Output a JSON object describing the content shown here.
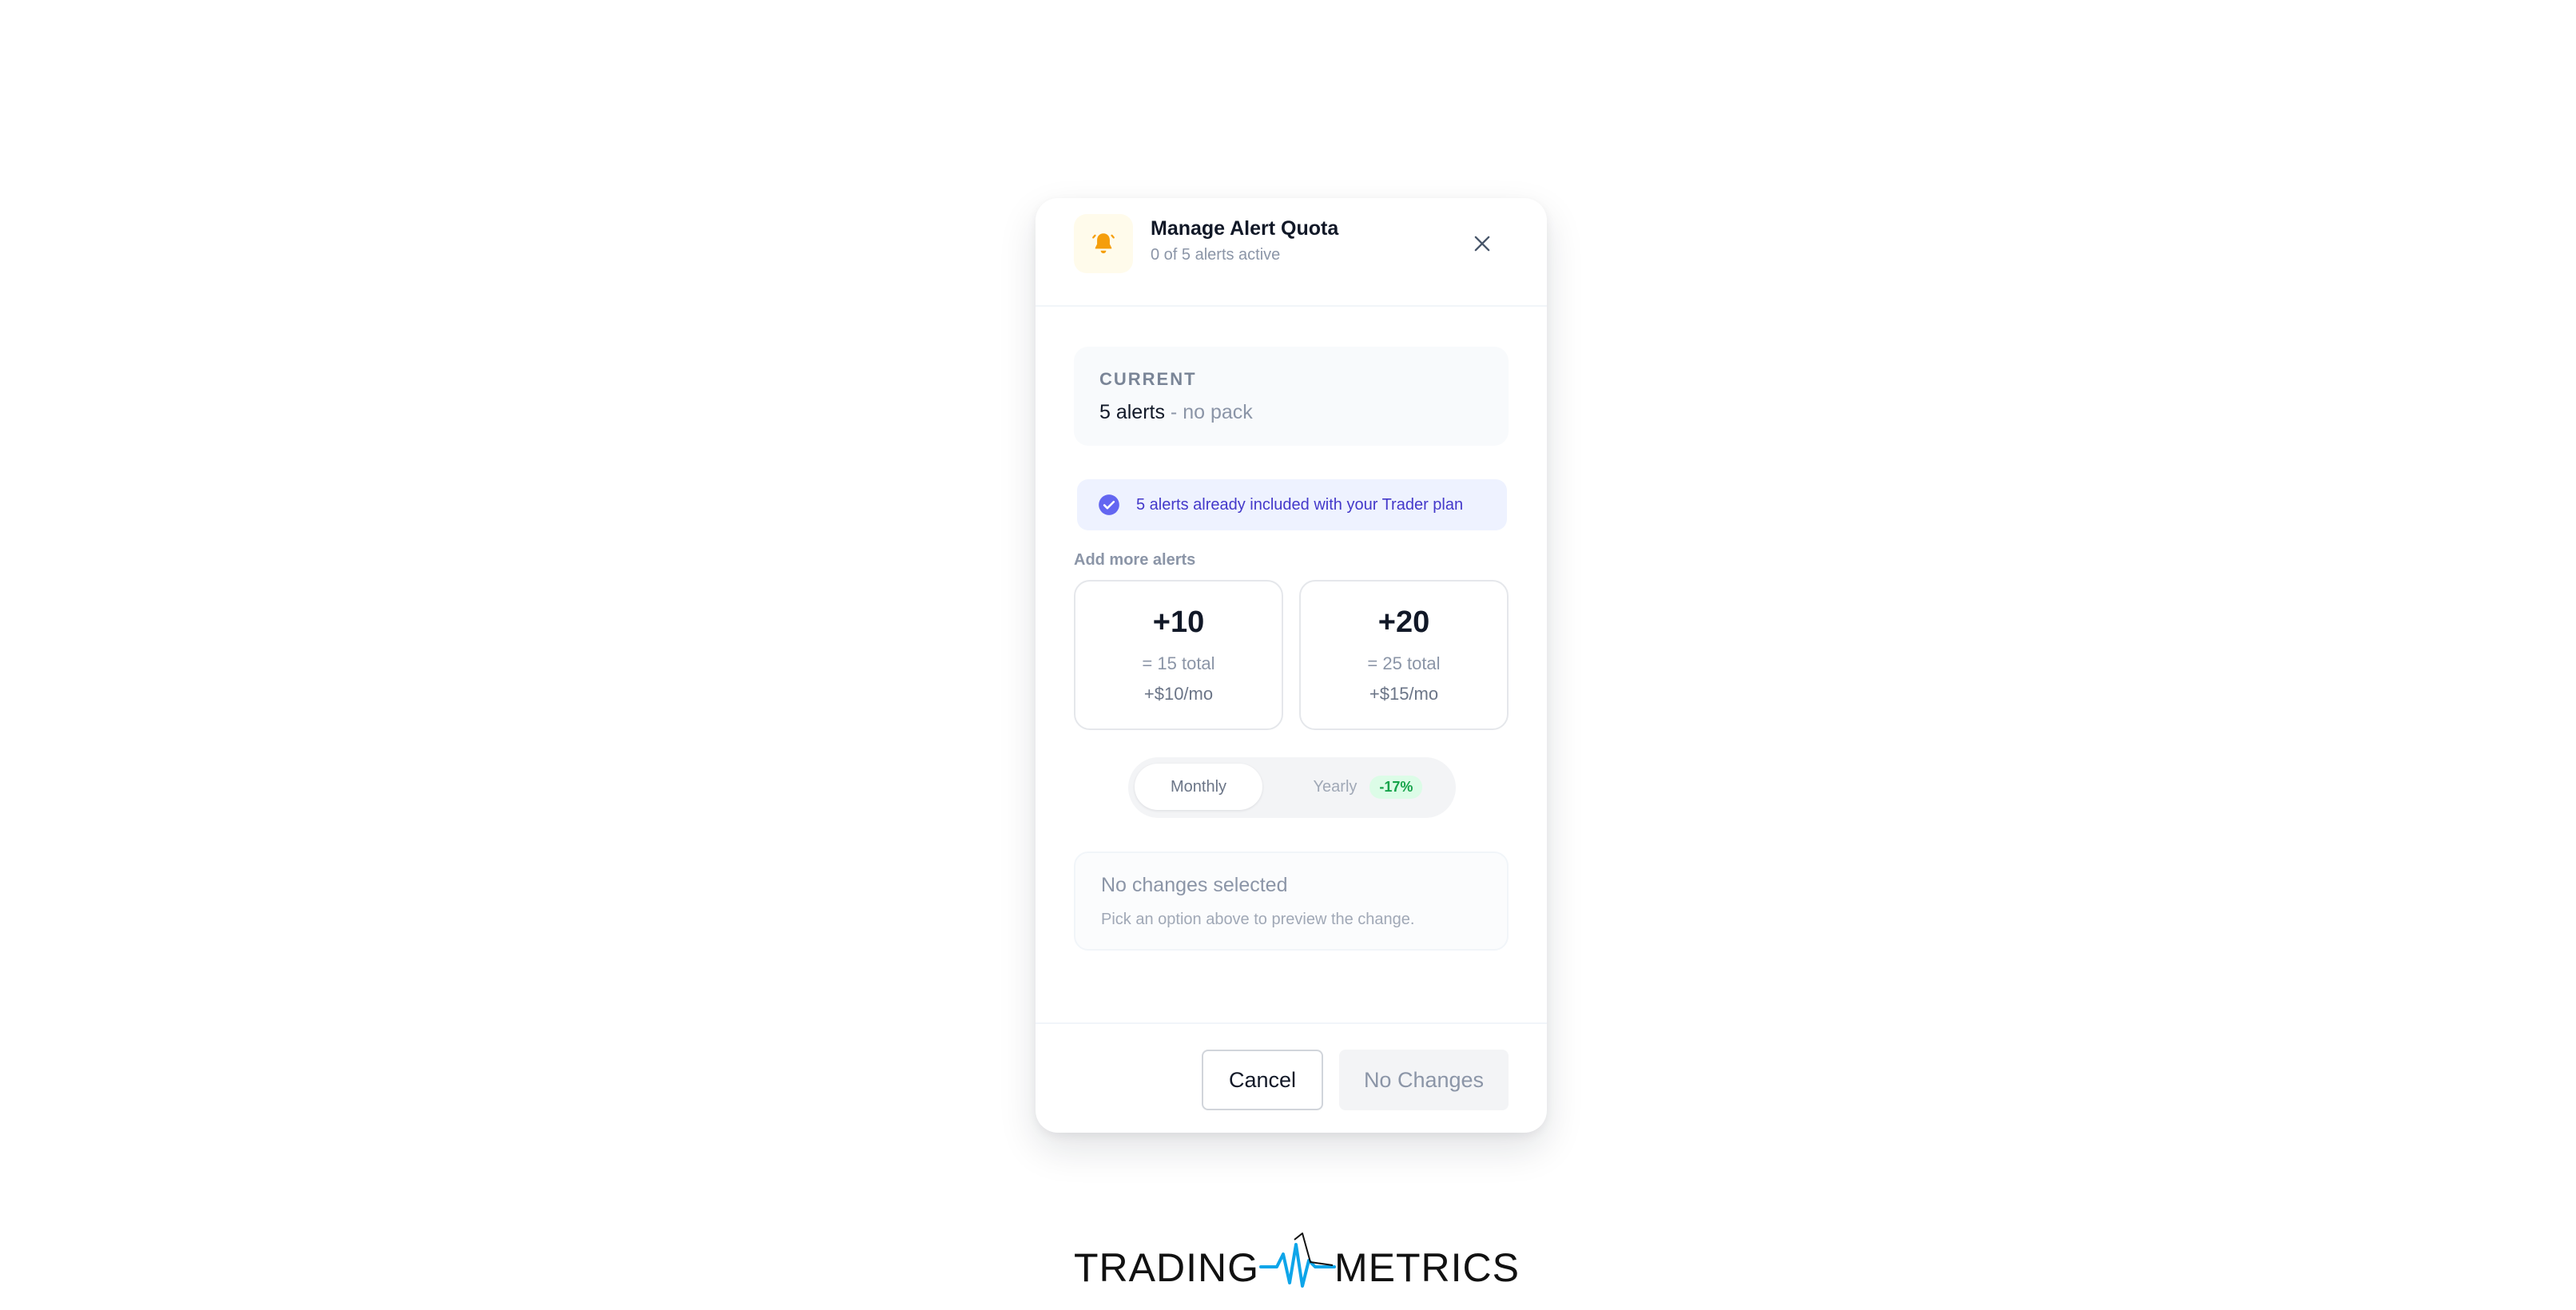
{
  "modal": {
    "title": "Manage Alert Quota",
    "subtitle": "0 of 5 alerts active",
    "icons": {
      "header": "bell-icon",
      "close": "close-icon",
      "included": "check-circle-icon"
    },
    "current": {
      "label": "CURRENT",
      "value": "5 alerts",
      "suffix": " - no pack"
    },
    "included_banner": "5 alerts already included with your Trader plan",
    "add_more_label": "Add more alerts",
    "packs": [
      {
        "amount": "+10",
        "total": "= 15 total",
        "price": "+$10/mo"
      },
      {
        "amount": "+20",
        "total": "= 25 total",
        "price": "+$15/mo"
      }
    ],
    "billing": {
      "monthly": "Monthly",
      "yearly": "Yearly",
      "yearly_discount": "-17%",
      "selected": "Monthly"
    },
    "preview": {
      "title": "No changes selected",
      "description": "Pick an option above to preview the change."
    },
    "footer": {
      "cancel": "Cancel",
      "confirm": "No Changes"
    }
  },
  "brand": {
    "left": "TRADING",
    "right": "METRICS",
    "logo_icon": "pulse-wave-icon"
  },
  "colors": {
    "accent_amber": "#f59e0b",
    "accent_indigo": "#6366f1",
    "success_green": "#16a34a",
    "text_dark": "#111827",
    "text_muted": "#8b95a7"
  }
}
